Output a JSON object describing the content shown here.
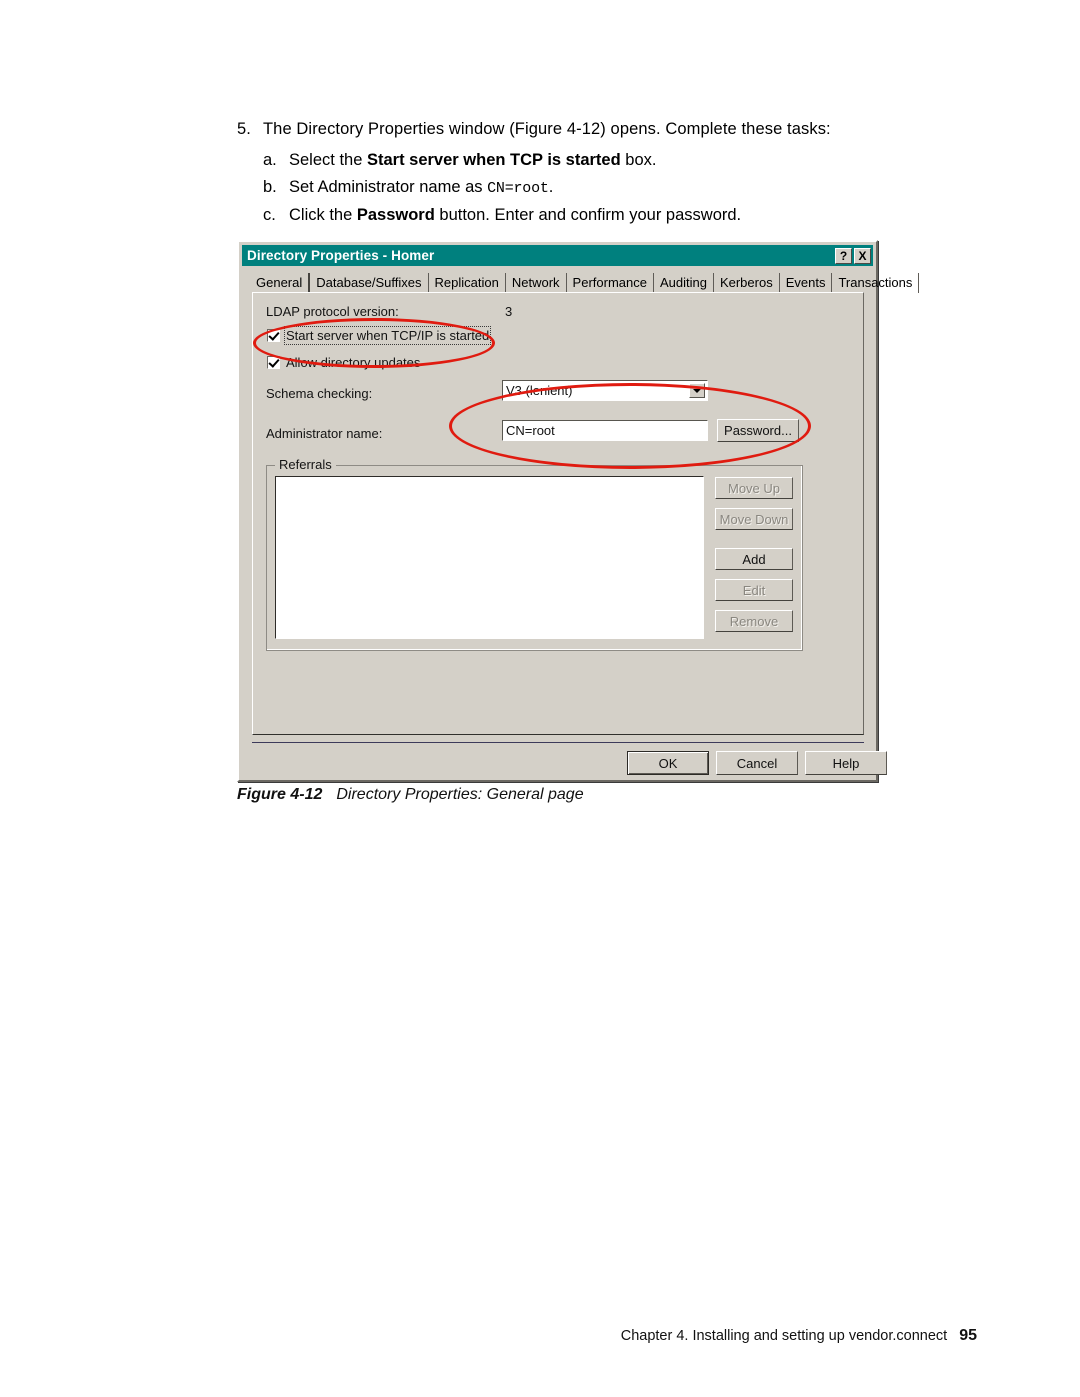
{
  "body_text": {
    "steps": [
      {
        "number": "5.",
        "text_before": "The Directory Properties window (Figure 4-12) opens. Complete these tasks:"
      }
    ],
    "substeps": [
      {
        "number": "a.",
        "pre": "Select the ",
        "bold": "Start server when TCP is started",
        "post": " box."
      },
      {
        "number": "b.",
        "pre": "Set Administrator name as ",
        "mono": "CN=root",
        "post": "."
      },
      {
        "number": "c.",
        "pre": "Click the ",
        "bold": "Password",
        "post": " button. Enter and confirm your password."
      }
    ]
  },
  "dialog": {
    "title": "Directory Properties - Homer",
    "title_buttons": [
      {
        "name": "help-icon",
        "label": "?"
      },
      {
        "name": "close-icon",
        "label": "X"
      }
    ],
    "tabs": [
      {
        "label": "General",
        "active": true
      },
      {
        "label": "Database/Suffixes",
        "active": false
      },
      {
        "label": "Replication",
        "active": false
      },
      {
        "label": "Network",
        "active": false
      },
      {
        "label": "Performance",
        "active": false
      },
      {
        "label": "Auditing",
        "active": false
      },
      {
        "label": "Kerberos",
        "active": false
      },
      {
        "label": "Events",
        "active": false
      },
      {
        "label": "Transactions",
        "active": false
      }
    ],
    "general": {
      "ldap_version_label": "LDAP protocol version:",
      "ldap_version_value": "3",
      "start_server_label": "Start server when TCP/IP is started",
      "start_server_checked": true,
      "allow_updates_label": "Allow directory updates",
      "allow_updates_checked": true,
      "schema_checking_label": "Schema checking:",
      "schema_checking_value": "V3 (lenient)",
      "administrator_name_label": "Administrator name:",
      "administrator_name_value": "CN=root",
      "password_button": "Password...",
      "referrals_group_label": "Referrals",
      "referrals_items": [],
      "referral_buttons": [
        {
          "label": "Move Up",
          "accel": "U",
          "enabled": false
        },
        {
          "label": "Move Down",
          "accel": "D",
          "enabled": false
        },
        {
          "label": "Add",
          "accel": "A",
          "enabled": true
        },
        {
          "label": "Edit",
          "accel": "E",
          "enabled": false
        },
        {
          "label": "Remove",
          "accel": "R",
          "enabled": false
        }
      ]
    },
    "footer_buttons": [
      {
        "label": "OK",
        "default": true
      },
      {
        "label": "Cancel",
        "default": false
      },
      {
        "label": "Help",
        "default": false
      }
    ],
    "colors": {
      "titlebar": "#00807e",
      "face": "#d4d0c8",
      "annotation": "#e01b10"
    }
  },
  "figure_caption": {
    "number": "Figure 4-12",
    "text": "Directory Properties: General page"
  },
  "page_footer": {
    "text": "Chapter 4. Installing and setting up vendor.connect",
    "page_number": "95"
  }
}
